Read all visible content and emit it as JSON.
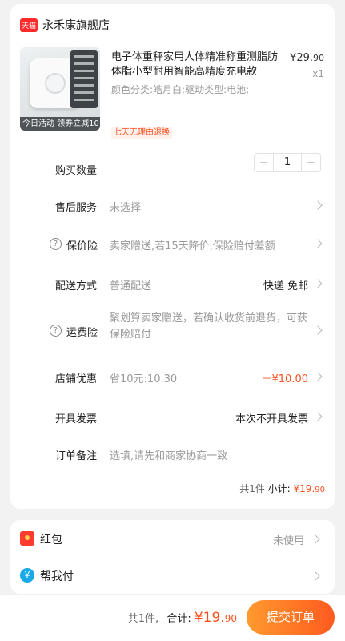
{
  "shop": {
    "badge": "天猫",
    "name": "永禾康旗舰店"
  },
  "product": {
    "title": "电子体重秤家用人体精准称重测脂肪体脂小型耐用智能高精度充电款",
    "price_symbol": "¥",
    "price_int": "29.",
    "price_dec": "90",
    "quantity_label": "x1",
    "spec": "颜色分类:皓月白;驱动类型:电池;",
    "thumb_banner": "今日活动 领券立减10",
    "return_tag": "七天无理由退换"
  },
  "rows": {
    "quantity": {
      "label": "购买数量",
      "minus": "−",
      "value": "1",
      "plus": "+"
    },
    "after_sales": {
      "label": "售后服务",
      "value": "未选择"
    },
    "price_protect": {
      "label": "保价险",
      "value": "卖家赠送,若15天降价,保险赔付差额"
    },
    "delivery": {
      "label": "配送方式",
      "value": "普通配送",
      "right": "快递 免邮"
    },
    "shipping_insurance": {
      "label": "运费险",
      "value": "聚划算卖家赠送，若确认收货前退货，可获保险赔付"
    },
    "shop_discount": {
      "label": "店铺优惠",
      "value": "省10元:10.30",
      "right": "－¥10.00"
    },
    "invoice": {
      "label": "开具发票",
      "right": "本次不开具发票"
    },
    "note": {
      "label": "订单备注",
      "placeholder": "选填,请先和商家协商一致"
    }
  },
  "subtotal": {
    "count": "共1件",
    "label": "小计:",
    "symbol": "¥",
    "int": "19.",
    "dec": "90"
  },
  "extras": {
    "hongbao": {
      "label": "红包",
      "right": "未使用",
      "icon": "red-envelope-icon"
    },
    "bangwo": {
      "label": "帮我付",
      "icon": "help-pay-icon",
      "glyph": "¥"
    }
  },
  "bottom": {
    "count": "共1件,",
    "total_label": "合计:",
    "symbol": "¥",
    "int": "19.",
    "dec": "90",
    "submit": "提交订单"
  },
  "colors": {
    "accent": "#ff4f1f",
    "tmall": "#ff2a2a",
    "button_start": "#ff9a2e",
    "button_end": "#ff5a1f"
  }
}
